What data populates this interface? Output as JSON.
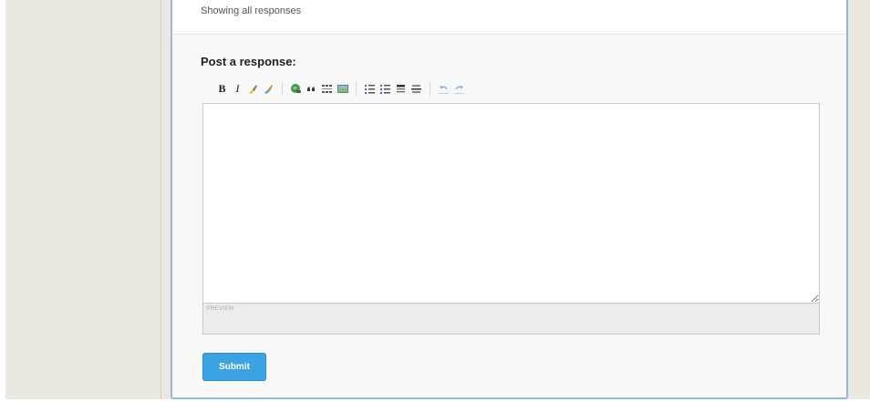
{
  "responses": {
    "status_text": "Showing all responses"
  },
  "form": {
    "label": "Post a response:",
    "toolbar": {
      "bold_label": "B",
      "italic_label": "I",
      "groups": [
        [
          "highlight-icon",
          "highlight-alt-icon"
        ],
        [
          "link-icon",
          "quote-icon",
          "code-icon",
          "image-icon"
        ],
        [
          "ordered-list-icon",
          "unordered-list-icon",
          "heading-icon",
          "horizontal-rule-icon"
        ],
        [
          "undo-icon",
          "redo-icon"
        ]
      ]
    },
    "editor_value": "",
    "preview_label": "PREVIEW",
    "submit_label": "Submit"
  },
  "colors": {
    "page_background": "#ebe8e1",
    "panel_border": "#9ab7d6",
    "submit_button": "#3ba3e3"
  }
}
